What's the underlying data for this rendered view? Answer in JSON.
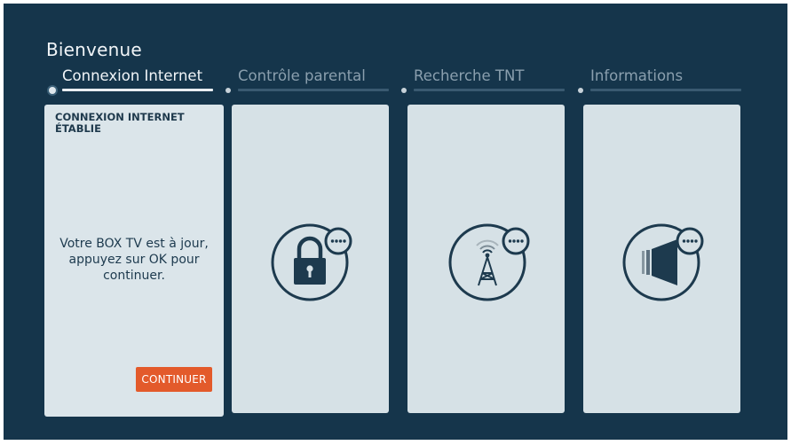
{
  "header": {
    "title": "Bienvenue"
  },
  "steps": [
    {
      "label": "Connexion Internet",
      "active": true
    },
    {
      "label": "Contrôle parental",
      "active": false
    },
    {
      "label": "Recherche TNT",
      "active": false
    },
    {
      "label": "Informations",
      "active": false
    }
  ],
  "cards": {
    "internet": {
      "heading": "CONNEXION INTERNET ÉTABLIE",
      "message": "Votre BOX TV est à jour, appuyez sur OK pour continuer.",
      "button_label": "CONTINUER"
    },
    "parental": {
      "icon": "padlock-icon"
    },
    "tnt": {
      "icon": "antenna-tower-icon"
    },
    "info": {
      "icon": "speaker-icon"
    }
  },
  "colors": {
    "background": "#15354b",
    "card": "#d6e1e6",
    "accent": "#e35a2b",
    "icon_stroke": "#1d3a4e"
  }
}
